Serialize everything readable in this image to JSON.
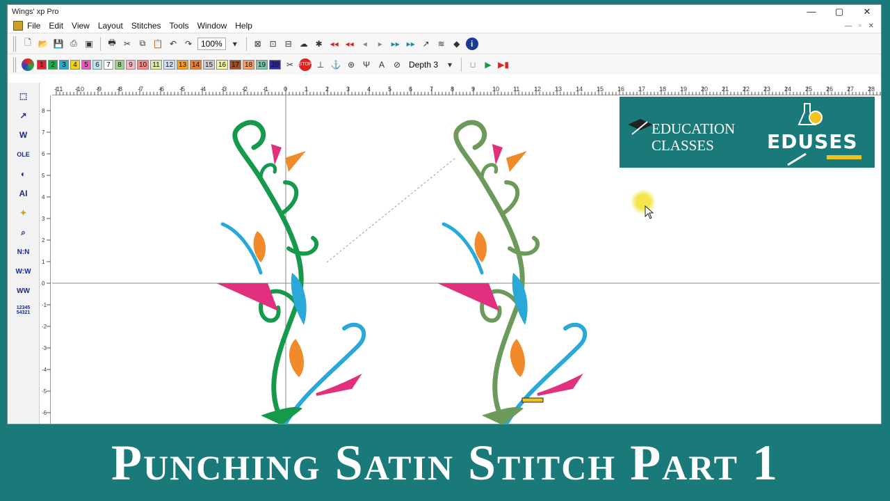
{
  "window": {
    "title": "Wings' xp Pro",
    "controls": [
      "—",
      "▢",
      "✕"
    ]
  },
  "menu": {
    "items": [
      "File",
      "Edit",
      "View",
      "Layout",
      "Stitches",
      "Tools",
      "Window",
      "Help"
    ],
    "mdi_controls": [
      "—",
      "▫",
      "✕"
    ]
  },
  "toolbar1": {
    "zoom": "100%"
  },
  "toolbar2": {
    "colors": [
      {
        "n": "1",
        "c": "#e0262b"
      },
      {
        "n": "2",
        "c": "#22a84a"
      },
      {
        "n": "3",
        "c": "#2aa8c8"
      },
      {
        "n": "4",
        "c": "#f2d21d"
      },
      {
        "n": "5",
        "c": "#e65fb4"
      },
      {
        "n": "6",
        "c": "#bde2f0"
      },
      {
        "n": "7",
        "c": "#ffffff"
      },
      {
        "n": "8",
        "c": "#9fd08f"
      },
      {
        "n": "9",
        "c": "#f4b9c6"
      },
      {
        "n": "10",
        "c": "#f08a8a"
      },
      {
        "n": "11",
        "c": "#dde9a8"
      },
      {
        "n": "12",
        "c": "#cfe0f4"
      },
      {
        "n": "13",
        "c": "#f2a11f"
      },
      {
        "n": "14",
        "c": "#e57e38"
      },
      {
        "n": "15",
        "c": "#cfcfcf"
      },
      {
        "n": "16",
        "c": "#f3f3a8"
      },
      {
        "n": "17",
        "c": "#a14d2a"
      },
      {
        "n": "18",
        "c": "#f59b68"
      },
      {
        "n": "19",
        "c": "#7fc2b0"
      },
      {
        "n": "20",
        "c": "#2b2b96"
      }
    ],
    "depth": "Depth 3"
  },
  "left_tools": [
    "select-arrow",
    "reshape",
    "satin",
    "design-ole",
    "fill",
    "AI",
    "sparkle",
    "zoom",
    "N-stitch",
    "W-stitch",
    "zigzag",
    "12345 54321"
  ],
  "ruler": {
    "top": [
      "-11",
      "-10",
      "-9",
      "-8",
      "-7",
      "-6",
      "-5",
      "-4",
      "-3",
      "-2",
      "-1",
      "0",
      "1",
      "2",
      "3",
      "4",
      "5",
      "6",
      "7",
      "8",
      "9",
      "10",
      "11",
      "12",
      "13",
      "14",
      "15",
      "16",
      "17",
      "18",
      "19",
      "20",
      "21",
      "22",
      "23",
      "24",
      "25",
      "26",
      "27",
      "28"
    ],
    "left": [
      "8",
      "7",
      "6",
      "5",
      "4",
      "3",
      "2",
      "1",
      "0",
      "-1",
      "-2",
      "-3",
      "-4",
      "-5",
      "-6"
    ]
  },
  "logo": {
    "line1": "EDUCATION",
    "line2": "CLASSES",
    "brand": "EDUSES"
  },
  "banner": {
    "text": "Punching Satin Stitch Part 1"
  }
}
